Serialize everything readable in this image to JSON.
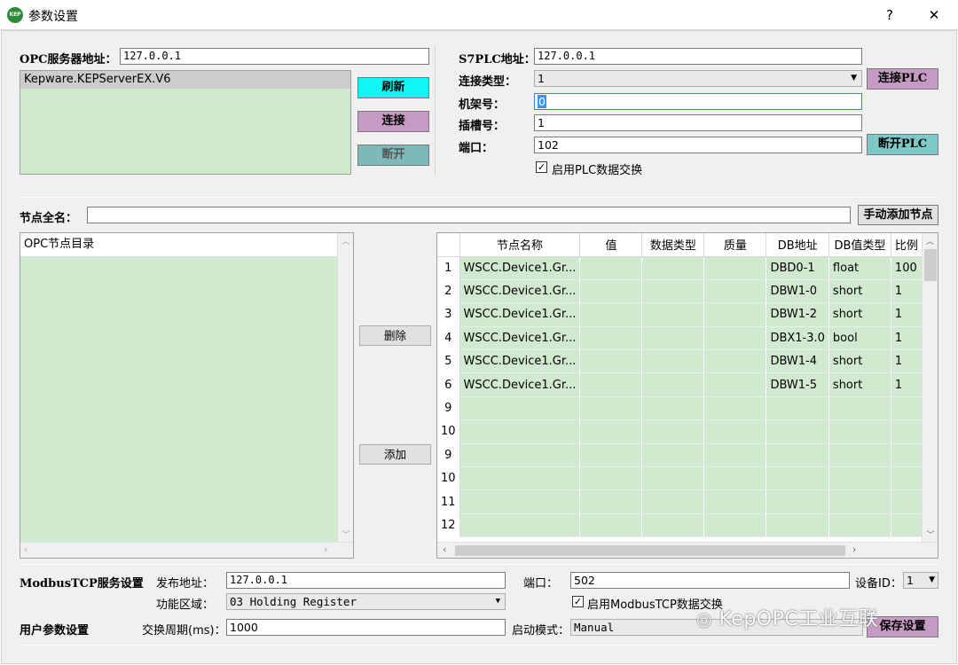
{
  "window": {
    "title": "参数设置",
    "help_glyph": "?",
    "close_glyph": "✕"
  },
  "opc": {
    "server_label": "OPC服务器地址：",
    "server_value": "127.0.0.1",
    "servers": [
      "Kepware.KEPServerEX.V6"
    ],
    "refresh_label": "刷新",
    "connect_label": "连接",
    "disconnect_label": "断开"
  },
  "plc": {
    "address_label": "S7PLC地址：",
    "address_value": "127.0.0.1",
    "conn_type_label": "连接类型：",
    "conn_type_value": "1",
    "rack_label": "机架号：",
    "rack_value": "0",
    "slot_label": "插槽号：",
    "slot_value": "1",
    "port_label": "端口：",
    "port_value": "102",
    "enable_label": "启用PLC数据交换",
    "connect_label": "连接PLC",
    "disconnect_label": "断开PLC"
  },
  "node": {
    "fullname_label": "节点全名：",
    "fullname_value": "",
    "add_manual_label": "手动添加节点",
    "tree_title": "OPC节点目录",
    "delete_label": "删除",
    "add_label": "添加"
  },
  "grid": {
    "columns": [
      "节点名称",
      "值",
      "数据类型",
      "质量",
      "DB地址",
      "DB值类型",
      "比例"
    ],
    "rows": [
      {
        "n": "1",
        "name": "WSCC.Device1.Gr...",
        "value": "",
        "dtype": "",
        "quality": "",
        "db": "DBD0-1",
        "dbtype": "float",
        "ratio": "100"
      },
      {
        "n": "2",
        "name": "WSCC.Device1.Gr...",
        "value": "",
        "dtype": "",
        "quality": "",
        "db": "DBW1-0",
        "dbtype": "short",
        "ratio": "1"
      },
      {
        "n": "3",
        "name": "WSCC.Device1.Gr...",
        "value": "",
        "dtype": "",
        "quality": "",
        "db": "DBW1-2",
        "dbtype": "short",
        "ratio": "1"
      },
      {
        "n": "4",
        "name": "WSCC.Device1.Gr...",
        "value": "",
        "dtype": "",
        "quality": "",
        "db": "DBX1-3.0",
        "dbtype": "bool",
        "ratio": "1"
      },
      {
        "n": "5",
        "name": "WSCC.Device1.Gr...",
        "value": "",
        "dtype": "",
        "quality": "",
        "db": "DBW1-4",
        "dbtype": "short",
        "ratio": "1"
      },
      {
        "n": "6",
        "name": "WSCC.Device1.Gr...",
        "value": "",
        "dtype": "",
        "quality": "",
        "db": "DBW1-5",
        "dbtype": "short",
        "ratio": "1"
      },
      {
        "n": "9",
        "name": "",
        "value": "",
        "dtype": "",
        "quality": "",
        "db": "",
        "dbtype": "",
        "ratio": ""
      },
      {
        "n": "10",
        "name": "",
        "value": "",
        "dtype": "",
        "quality": "",
        "db": "",
        "dbtype": "",
        "ratio": ""
      },
      {
        "n": "9",
        "name": "",
        "value": "",
        "dtype": "",
        "quality": "",
        "db": "",
        "dbtype": "",
        "ratio": ""
      },
      {
        "n": "10",
        "name": "",
        "value": "",
        "dtype": "",
        "quality": "",
        "db": "",
        "dbtype": "",
        "ratio": ""
      },
      {
        "n": "11",
        "name": "",
        "value": "",
        "dtype": "",
        "quality": "",
        "db": "",
        "dbtype": "",
        "ratio": ""
      },
      {
        "n": "12",
        "name": "",
        "value": "",
        "dtype": "",
        "quality": "",
        "db": "",
        "dbtype": "",
        "ratio": ""
      }
    ]
  },
  "modbus": {
    "section_label": "ModbusTCP服务设置",
    "publish_label": "发布地址：",
    "publish_value": "127.0.0.1",
    "port_label": "端口：",
    "port_value": "502",
    "device_id_label": "设备ID：",
    "device_id_value": "1",
    "func_label": "功能区域：",
    "func_value": "03 Holding Register",
    "enable_label": "启用ModbusTCP数据交换"
  },
  "user": {
    "section_label": "用户参数设置",
    "cycle_label": "交换周期(ms)：",
    "cycle_value": "1000",
    "mode_label": "启动模式：",
    "mode_value": "Manual",
    "save_label": "保存设置"
  },
  "watermark": "KepOPC工业互联"
}
